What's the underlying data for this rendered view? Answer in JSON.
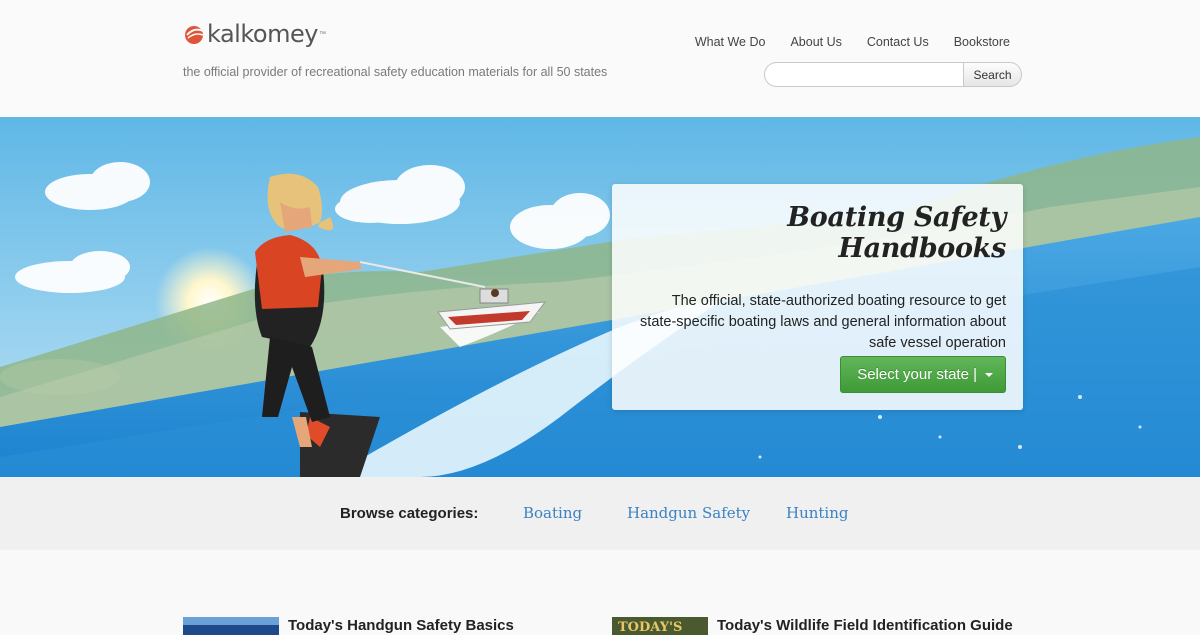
{
  "header": {
    "logo_text": "kalkomey",
    "logo_tm": "™",
    "tagline": "the official provider of recreational safety education materials for all 50 states",
    "nav": [
      "What We Do",
      "About Us",
      "Contact Us",
      "Bookstore"
    ],
    "search": {
      "placeholder": "",
      "button": "Search"
    }
  },
  "hero": {
    "title": "Boating Safety Handbooks",
    "description": "The official, state-authorized boating resource to get state-specific boating laws and general information about safe vessel operation",
    "cta_label": "Select your state |"
  },
  "categories": {
    "label": "Browse categories:",
    "items": [
      "Boating",
      "Handgun Safety",
      "Hunting"
    ]
  },
  "teasers": [
    {
      "title": "Today's Handgun Safety Basics",
      "image_text": ""
    },
    {
      "title": "Today's Wildlife Field Identification Guide",
      "image_text": "TODAY'S"
    }
  ],
  "colors": {
    "accent_green": "#4caf44",
    "link_blue": "#3b82c4",
    "logo_red": "#e0553a"
  }
}
